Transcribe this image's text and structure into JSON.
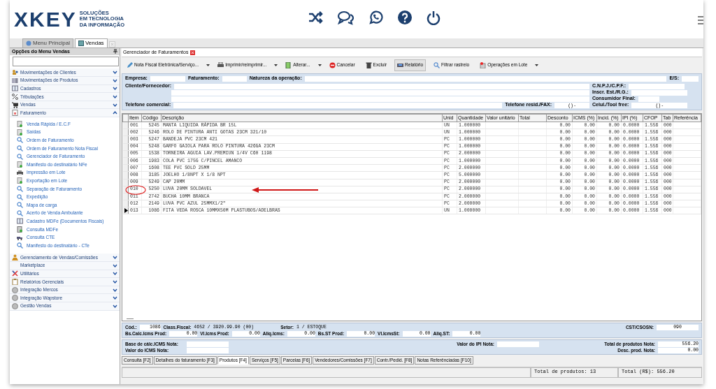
{
  "header": {
    "logo": "XKEY",
    "tagline": [
      "SOLUÇÕES",
      "EM TECNOLOGIA",
      "DA INFORMAÇÃO"
    ]
  },
  "top_tabs": [
    {
      "label": "Menu Principal",
      "selected": false
    },
    {
      "label": "Vendas",
      "selected": true
    }
  ],
  "sidebar": {
    "title": "Opções do Menu Vendas",
    "groups": [
      {
        "label": "Movimentações de Clientes",
        "expanded": false
      },
      {
        "label": "Movimentações de Produtos",
        "expanded": false
      },
      {
        "label": "Cadastros",
        "expanded": false
      },
      {
        "label": "Tributações",
        "expanded": false
      },
      {
        "label": "Vendas",
        "expanded": false
      },
      {
        "label": "Faturamento",
        "expanded": true,
        "children": [
          "Venda Rápida / E.C.F",
          "Saídas",
          "Ordem de Faturamento",
          "Ordem de Faturamento Nota Fiscal",
          "Gerenciador de Faturamento",
          "Manifesto do destinatário NFe",
          "Impressão em Lote",
          "Exportação em Lote",
          "Separação de Faturamento",
          "Expedição",
          "Mapa de carga",
          "Acerto de Venda Ambulante",
          "Cadastro MDFe (Documentos Fiscais)",
          "Consulta MDFe",
          "Consulta CTE",
          "Manifesto do destinatário - CTe"
        ]
      },
      {
        "label": "Gerenciamento de Vendas/Comissões",
        "expanded": false
      },
      {
        "label": "Marketplace",
        "expanded": false
      },
      {
        "label": "Utilitários",
        "expanded": false
      },
      {
        "label": "Relatórios Gerenciais",
        "expanded": false
      },
      {
        "label": "Integração Mercos",
        "expanded": false
      },
      {
        "label": "Integração Wapstore",
        "expanded": false
      },
      {
        "label": "Gestão Vendas",
        "expanded": false
      }
    ]
  },
  "document_tab": "Gerenciador de Faturamentos",
  "toolbar": [
    {
      "label": "Nota Fiscal Eletrônica/Serviço...",
      "dropdown": true,
      "pressed": false
    },
    {
      "label": "Imprimir/reimprimir...",
      "dropdown": true,
      "pressed": false
    },
    {
      "label": "Alterar...",
      "dropdown": true,
      "pressed": false
    },
    {
      "label": "Cancelar",
      "dropdown": false,
      "pressed": false
    },
    {
      "label": "Excluir",
      "dropdown": false,
      "pressed": false
    },
    {
      "label": "Relatório",
      "dropdown": false,
      "pressed": true
    },
    {
      "label": "Filtrar rastreio",
      "dropdown": false,
      "pressed": false
    },
    {
      "label": "Operações em Lote",
      "dropdown": true,
      "pressed": false
    }
  ],
  "form": {
    "empresa": "Empresa:",
    "faturamento": "Faturamento:",
    "natureza": "Natureza da operação:",
    "es": "E/S:",
    "cliente": "Cliente/Fornecedor:",
    "cnpj": "C.N.P.J./C.P.F.:",
    "inscr": "Inscr. Est./R.G.:",
    "consumidor": "Consumidor Final:",
    "telefone": "Telefone comercial:",
    "telefone_resid": {
      "label": "Telefone resid./FAX:",
      "value": "(     )       -"
    },
    "celular": {
      "label": "Celul./Tool free:",
      "value": "(     )       -"
    }
  },
  "table": {
    "columns": [
      "Item",
      "Código",
      "Descrição",
      "Unid",
      "Quantidade",
      "Valor unitário",
      "Total",
      "Desconto",
      "ICMS (%)",
      "Incid. (%)",
      "IPI (%)",
      "CFOP",
      "Tab",
      "Referência"
    ],
    "rows": [
      {
        "item": "001",
        "codigo": "5245",
        "descricao": "MANTA LIQUIDA RÁPIDA BR 15L",
        "unid": "UN",
        "quantidade": "1.000000",
        "desconto": "0.00",
        "icms": "0.00",
        "incid": "0.00",
        "ipi": "0.0000",
        "cfop": "1.556",
        "tab": "000",
        "selected": false,
        "circled": false
      },
      {
        "item": "002",
        "codigo": "5246",
        "descricao": "ROLO DE PINTURA ANTI GOTAS 23CM 321/10",
        "unid": "UN",
        "quantidade": "1.000000",
        "desconto": "0.00",
        "icms": "0.00",
        "incid": "0.00",
        "ipi": "0.0000",
        "cfop": "1.556",
        "tab": "000",
        "selected": false,
        "circled": false
      },
      {
        "item": "003",
        "codigo": "5247",
        "descricao": "BANDEJA PVC 23CM 421",
        "unid": "PC",
        "quantidade": "1.000000",
        "desconto": "0.00",
        "icms": "0.00",
        "incid": "0.00",
        "ipi": "0.0000",
        "cfop": "1.556",
        "tab": "000",
        "selected": false,
        "circled": false
      },
      {
        "item": "004",
        "codigo": "5248",
        "descricao": "GARFO GAIOLA PARA ROLO PINTURA 426GA 23CM",
        "unid": "PC",
        "quantidade": "1.000000",
        "desconto": "0.00",
        "icms": "0.00",
        "incid": "0.00",
        "ipi": "0.0000",
        "cfop": "1.556",
        "tab": "000",
        "selected": false,
        "circled": false
      },
      {
        "item": "005",
        "codigo": "1538",
        "descricao": "TORNEIRA AGUIA LAV.PREMIUN 1/4V C60 1198",
        "unid": "PC",
        "quantidade": "2.000000",
        "desconto": "0.00",
        "icms": "0.00",
        "incid": "0.00",
        "ipi": "0.0000",
        "cfop": "1.556",
        "tab": "000",
        "selected": false,
        "circled": false
      },
      {
        "item": "006",
        "codigo": "1983",
        "descricao": "COLA PVC 175G C/PINCEL AMANCO",
        "unid": "PC",
        "quantidade": "1.000000",
        "desconto": "0.00",
        "icms": "0.00",
        "incid": "0.00",
        "ipi": "0.0000",
        "cfop": "1.556",
        "tab": "000",
        "selected": false,
        "circled": false
      },
      {
        "item": "007",
        "codigo": "1608",
        "descricao": "TEE PVC SOLD 25MM",
        "unid": "PC",
        "quantidade": "2.000000",
        "desconto": "0.00",
        "icms": "0.00",
        "incid": "0.00",
        "ipi": "0.0000",
        "cfop": "1.556",
        "tab": "000",
        "selected": false,
        "circled": false
      },
      {
        "item": "008",
        "codigo": "3185",
        "descricao": "JOELHO 1/8NPT X 1/8 NPT",
        "unid": "PC",
        "quantidade": "5.000000",
        "desconto": "0.00",
        "icms": "0.00",
        "incid": "0.00",
        "ipi": "0.0000",
        "cfop": "1.556",
        "tab": "000",
        "selected": false,
        "circled": false
      },
      {
        "item": "009",
        "codigo": "5249",
        "descricao": "CAP 20MM",
        "unid": "PC",
        "quantidade": "2.000000",
        "desconto": "0.00",
        "icms": "0.00",
        "incid": "0.00",
        "ipi": "0.0000",
        "cfop": "1.556",
        "tab": "000",
        "selected": false,
        "circled": false
      },
      {
        "item": "010",
        "codigo": "5250",
        "descricao": "LUVA 20MM SOLDAVEL",
        "unid": "PC",
        "quantidade": "2.000000",
        "desconto": "0.00",
        "icms": "0.00",
        "incid": "0.00",
        "ipi": "0.0000",
        "cfop": "1.556",
        "tab": "000",
        "selected": false,
        "circled": true
      },
      {
        "item": "011",
        "codigo": "2742",
        "descricao": "BUCHA 10MM BRANCA",
        "unid": "PC",
        "quantidade": "2.000000",
        "desconto": "0.00",
        "icms": "0.00",
        "incid": "0.00",
        "ipi": "0.0000",
        "cfop": "1.556",
        "tab": "000",
        "selected": false,
        "circled": false
      },
      {
        "item": "012",
        "codigo": "2149",
        "descricao": "LUVA PVC AZUL 25MMX1/2\"",
        "unid": "PC",
        "quantidade": "2.000000",
        "desconto": "0.00",
        "icms": "0.00",
        "incid": "0.00",
        "ipi": "0.0000",
        "cfop": "1.556",
        "tab": "000",
        "selected": false,
        "circled": false
      },
      {
        "item": "013",
        "codigo": "1086",
        "descricao": "FITA VEDA ROSCA 10MMX50M PLASTUBOS/ADELBRAS",
        "unid": "UN",
        "quantidade": "1.000000",
        "desconto": "0.00",
        "icms": "0.00",
        "incid": "0.00",
        "ipi": "0.0000",
        "cfop": "1.556",
        "tab": "000",
        "selected": true,
        "circled": false
      }
    ]
  },
  "details": {
    "cod": {
      "label": "Cód.:",
      "value": "1086"
    },
    "class_fiscal": {
      "label": "Class.Fiscal:",
      "value": "4652 / 3920.99.90 (00)"
    },
    "setor": {
      "label": "Setor:",
      "value": "1 / ESTOQUE"
    },
    "cst": {
      "label": "CST/CSOSN:",
      "value": "090"
    },
    "taxes": [
      {
        "label": "Bs.Calc.Icms Prod:",
        "value": "0.00"
      },
      {
        "label": "Vl.Icms Prod:",
        "value": "0.00"
      },
      {
        "label": "Aliq.Icms:",
        "value": "0.00"
      },
      {
        "label": "Bs.ST Prod:",
        "value": "0.00"
      },
      {
        "label": "Vl.IcmsSt:",
        "value": "0.00"
      },
      {
        "label": "Aliq.ST:",
        "value": "0.00"
      }
    ]
  },
  "totals": {
    "base_icms": "Base de cálc.ICMS Nota:",
    "valor_icms": "Valor do ICMS Nota:",
    "valor_ipi": "Valor do IPI Nota:",
    "total_produtos": {
      "label": "Total de produtos Nota:",
      "value": "556.20"
    },
    "desc_prod": {
      "label": "Desc. prod. Nota:",
      "value": "0.00"
    }
  },
  "bottom_tabs": [
    {
      "label": "Consulta [F2]",
      "selected": false
    },
    {
      "label": "Detalhes do faturamento [F3]",
      "selected": false
    },
    {
      "label": "Produtos [F4]",
      "selected": true
    },
    {
      "label": "Serviços [F5]",
      "selected": false
    },
    {
      "label": "Parcelas [F6]",
      "selected": false
    },
    {
      "label": "Vendedores/Comissões [F7]",
      "selected": false
    },
    {
      "label": "Contr./Pedid. [F8]",
      "selected": false
    },
    {
      "label": "Notas Referênciadas [F10]",
      "selected": false
    }
  ],
  "status_bar": {
    "count": "Total de produtos: 13",
    "total": "Total (R$): 556.20"
  }
}
